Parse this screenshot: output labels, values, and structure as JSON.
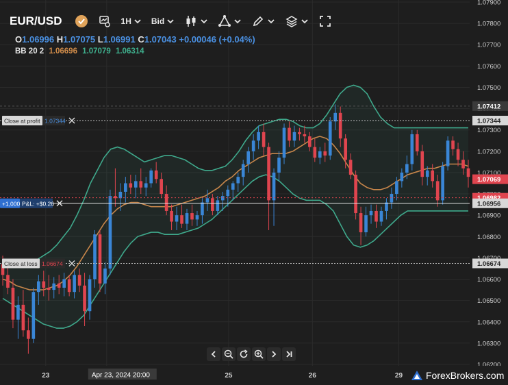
{
  "toolbar": {
    "symbol": "EUR/USD",
    "timeframe": "1H",
    "price_type": "Bid"
  },
  "ohlc": {
    "o_label": "O",
    "o_value": "1.06996",
    "h_label": "H",
    "h_value": "1.07075",
    "l_label": "L",
    "l_value": "1.06991",
    "c_label": "C",
    "c_value": "1.07043",
    "change": "+0.00046 (+0.04%)"
  },
  "indicator": {
    "name": "BB 20 2",
    "middle": "1.06696",
    "upper": "1.07079",
    "lower": "1.06314"
  },
  "orders": {
    "take_profit": {
      "label": "Close at profit",
      "price": "1.07344"
    },
    "stop_loss": {
      "label": "Close at loss",
      "price": "1.06674"
    },
    "position": {
      "size": "+1,000",
      "pnl": "P&L: +$0.26",
      "price": "1.06956"
    }
  },
  "price_markers": {
    "crosshair": "1.07412",
    "last_price": "1.07069",
    "bid_ask": "1.06982"
  },
  "brand": {
    "name": "ForexBrokers.com"
  },
  "colors": {
    "bull": "#3a86d6",
    "bear": "#e0454f",
    "bb_band": "#3fa98c",
    "bb_mid": "#c9874b",
    "background": "#1e1e1e"
  },
  "chart_data": {
    "type": "candlestick",
    "ylim": [
      1.062,
      1.079
    ],
    "y_ticks": [
      "1.07900",
      "1.07800",
      "1.07700",
      "1.07600",
      "1.07500",
      "1.07400",
      "1.07300",
      "1.07200",
      "1.07100",
      "1.07000",
      "1.06900",
      "1.06800",
      "1.06700",
      "1.06600",
      "1.06500",
      "1.06400",
      "1.06300",
      "1.06200"
    ],
    "x_ticks": [
      "23",
      "Apr 23, 2024  20:00",
      "25",
      "26",
      "29"
    ],
    "x_tick_positions": [
      0.09,
      0.21,
      0.45,
      0.615,
      0.785
    ],
    "series": [
      {
        "name": "EUR/USD",
        "candles": [
          [
            1.0667,
            1.0671,
            1.0657,
            1.0662
          ],
          [
            1.0662,
            1.0668,
            1.0653,
            1.0656
          ],
          [
            1.0656,
            1.066,
            1.0637,
            1.0641
          ],
          [
            1.0641,
            1.0652,
            1.0632,
            1.0648
          ],
          [
            1.0648,
            1.0655,
            1.0633,
            1.0636
          ],
          [
            1.0636,
            1.0642,
            1.0625,
            1.0632
          ],
          [
            1.0632,
            1.0656,
            1.063,
            1.0654
          ],
          [
            1.0654,
            1.0662,
            1.0648,
            1.0659
          ],
          [
            1.0659,
            1.0664,
            1.0652,
            1.0656
          ],
          [
            1.0656,
            1.0662,
            1.065,
            1.0655
          ],
          [
            1.0655,
            1.0661,
            1.0651,
            1.0658
          ],
          [
            1.0658,
            1.0662,
            1.0653,
            1.0656
          ],
          [
            1.0656,
            1.0663,
            1.0652,
            1.066
          ],
          [
            1.066,
            1.0662,
            1.0652,
            1.0654
          ],
          [
            1.0654,
            1.0664,
            1.0651,
            1.0662
          ],
          [
            1.0662,
            1.0665,
            1.0654,
            1.0657
          ],
          [
            1.0657,
            1.0663,
            1.0638,
            1.0645
          ],
          [
            1.0645,
            1.0662,
            1.0641,
            1.066
          ],
          [
            1.066,
            1.0683,
            1.0656,
            1.0681
          ],
          [
            1.0681,
            1.0683,
            1.0654,
            1.0658
          ],
          [
            1.0658,
            1.0668,
            1.0653,
            1.0665
          ],
          [
            1.0665,
            1.0702,
            1.0662,
            1.0699
          ],
          [
            1.0699,
            1.0712,
            1.0694,
            1.0698
          ],
          [
            1.0698,
            1.0705,
            1.0692,
            1.0701
          ],
          [
            1.0701,
            1.0708,
            1.0696,
            1.0705
          ],
          [
            1.0705,
            1.0709,
            1.07,
            1.0703
          ],
          [
            1.0703,
            1.0709,
            1.0698,
            1.0706
          ],
          [
            1.0706,
            1.0712,
            1.07,
            1.0703
          ],
          [
            1.0703,
            1.0708,
            1.0699,
            1.0705
          ],
          [
            1.0705,
            1.0712,
            1.0703,
            1.0711
          ],
          [
            1.0711,
            1.0715,
            1.0705,
            1.0707
          ],
          [
            1.0707,
            1.071,
            1.0698,
            1.07
          ],
          [
            1.07,
            1.0704,
            1.069,
            1.0692
          ],
          [
            1.0692,
            1.0695,
            1.0683,
            1.0687
          ],
          [
            1.0687,
            1.0694,
            1.0683,
            1.069
          ],
          [
            1.069,
            1.0695,
            1.0684,
            1.0686
          ],
          [
            1.0686,
            1.0693,
            1.0683,
            1.0691
          ],
          [
            1.0691,
            1.0695,
            1.0685,
            1.0688
          ],
          [
            1.0688,
            1.0692,
            1.0685,
            1.069
          ],
          [
            1.069,
            1.0698,
            1.0686,
            1.0696
          ],
          [
            1.0696,
            1.0702,
            1.0692,
            1.0698
          ],
          [
            1.0698,
            1.07,
            1.069,
            1.0692
          ],
          [
            1.0692,
            1.0699,
            1.069,
            1.0697
          ],
          [
            1.0697,
            1.0701,
            1.0692,
            1.0699
          ],
          [
            1.0699,
            1.0704,
            1.0694,
            1.0702
          ],
          [
            1.0702,
            1.0706,
            1.0697,
            1.0705
          ],
          [
            1.0705,
            1.071,
            1.0701,
            1.0708
          ],
          [
            1.0708,
            1.0716,
            1.0704,
            1.0714
          ],
          [
            1.0714,
            1.0722,
            1.071,
            1.072
          ],
          [
            1.072,
            1.0728,
            1.0716,
            1.0725
          ],
          [
            1.0725,
            1.0732,
            1.0721,
            1.0729
          ],
          [
            1.0729,
            1.0733,
            1.0718,
            1.0722
          ],
          [
            1.0722,
            1.0724,
            1.0683,
            1.0697
          ],
          [
            1.0697,
            1.0712,
            1.0685,
            1.071
          ],
          [
            1.071,
            1.072,
            1.0706,
            1.0717
          ],
          [
            1.0717,
            1.0733,
            1.0714,
            1.0731
          ],
          [
            1.0731,
            1.0734,
            1.0722,
            1.0725
          ],
          [
            1.0725,
            1.0732,
            1.0722,
            1.0729
          ],
          [
            1.0729,
            1.0731,
            1.0725,
            1.0728
          ],
          [
            1.0728,
            1.0732,
            1.0724,
            1.0727
          ],
          [
            1.0727,
            1.0729,
            1.072,
            1.0722
          ],
          [
            1.0722,
            1.0726,
            1.0715,
            1.0717
          ],
          [
            1.0717,
            1.0722,
            1.0714,
            1.072
          ],
          [
            1.072,
            1.0724,
            1.0715,
            1.0718
          ],
          [
            1.0718,
            1.0736,
            1.0716,
            1.0734
          ],
          [
            1.0734,
            1.0742,
            1.073,
            1.0738
          ],
          [
            1.0738,
            1.0741,
            1.0722,
            1.0726
          ],
          [
            1.0726,
            1.0728,
            1.0712,
            1.0716
          ],
          [
            1.0716,
            1.0719,
            1.0707,
            1.0709
          ],
          [
            1.0709,
            1.0711,
            1.0688,
            1.0691
          ],
          [
            1.0691,
            1.0694,
            1.0676,
            1.0682
          ],
          [
            1.0682,
            1.0694,
            1.068,
            1.069
          ],
          [
            1.069,
            1.0695,
            1.0686,
            1.0692
          ],
          [
            1.0692,
            1.0695,
            1.0684,
            1.0687
          ],
          [
            1.0687,
            1.0694,
            1.0685,
            1.0692
          ],
          [
            1.0692,
            1.0698,
            1.0688,
            1.0696
          ],
          [
            1.0696,
            1.0703,
            1.0693,
            1.07
          ],
          [
            1.07,
            1.0708,
            1.0697,
            1.0706
          ],
          [
            1.0706,
            1.0712,
            1.0703,
            1.071
          ],
          [
            1.071,
            1.0718,
            1.0707,
            1.0714
          ],
          [
            1.0714,
            1.073,
            1.0711,
            1.0728
          ],
          [
            1.0728,
            1.073,
            1.0718,
            1.072
          ],
          [
            1.072,
            1.0723,
            1.0704,
            1.0708
          ],
          [
            1.0708,
            1.0713,
            1.0704,
            1.0711
          ],
          [
            1.0711,
            1.0714,
            1.0703,
            1.0706
          ],
          [
            1.0706,
            1.0709,
            1.0694,
            1.0697
          ],
          [
            1.0697,
            1.0715,
            1.0695,
            1.0713
          ],
          [
            1.0713,
            1.0727,
            1.0711,
            1.0725
          ],
          [
            1.0725,
            1.0727,
            1.0718,
            1.0721
          ],
          [
            1.0721,
            1.0724,
            1.0713,
            1.0716
          ],
          [
            1.0716,
            1.072,
            1.0709,
            1.0712
          ],
          [
            1.0712,
            1.0716,
            1.0703,
            1.0708
          ]
        ]
      },
      {
        "name": "BB 20 2 upper",
        "values": [
          1.0668,
          1.0668,
          1.0667,
          1.0667,
          1.0668,
          1.0669,
          1.0671,
          1.0673,
          1.0676,
          1.068,
          1.0684,
          1.069,
          1.0697,
          1.0705,
          1.0711,
          1.0717,
          1.0721,
          1.0722,
          1.0721,
          1.0719,
          1.0717,
          1.0715,
          1.0716,
          1.0717,
          1.0718,
          1.0718,
          1.0717,
          1.0716,
          1.0714,
          1.0712,
          1.0711,
          1.0711,
          1.0712,
          1.0713,
          1.0716,
          1.072,
          1.0725,
          1.0729,
          1.0732,
          1.0733,
          1.0734,
          1.0735,
          1.0735,
          1.0734,
          1.0732,
          1.0731,
          1.0731,
          1.0733,
          1.0737,
          1.0742,
          1.0747,
          1.075,
          1.0751,
          1.075,
          1.0747,
          1.0741,
          1.0736,
          1.0733,
          1.0731,
          1.0731,
          1.0731,
          1.0731,
          1.0731,
          1.0731,
          1.0731,
          1.0731,
          1.0731,
          1.0731,
          1.0731,
          1.0731
        ]
      },
      {
        "name": "BB 20 2 middle",
        "values": [
          1.066,
          1.0659,
          1.0657,
          1.0656,
          1.0655,
          1.0655,
          1.0655,
          1.0656,
          1.0657,
          1.0659,
          1.0662,
          1.0666,
          1.0671,
          1.0676,
          1.0681,
          1.0686,
          1.069,
          1.0693,
          1.0695,
          1.0696,
          1.0696,
          1.0695,
          1.0694,
          1.0694,
          1.0694,
          1.0694,
          1.0695,
          1.0696,
          1.0697,
          1.0698,
          1.0699,
          1.0701,
          1.0703,
          1.0706,
          1.0708,
          1.0711,
          1.0713,
          1.0715,
          1.0717,
          1.0718,
          1.0719,
          1.0719,
          1.0719,
          1.072,
          1.0722,
          1.0724,
          1.0726,
          1.0727,
          1.0726,
          1.0723,
          1.0719,
          1.0714,
          1.0709,
          1.0705,
          1.0703,
          1.0702,
          1.0702,
          1.0703,
          1.0705,
          1.0707,
          1.0709,
          1.071,
          1.0711,
          1.0712,
          1.0712,
          1.0713,
          1.0714,
          1.0714,
          1.0714,
          1.0713
        ]
      },
      {
        "name": "BB 20 2 lower",
        "values": [
          1.0651,
          1.0649,
          1.0647,
          1.0645,
          1.0643,
          1.0641,
          1.0639,
          1.0638,
          1.0637,
          1.0637,
          1.0638,
          1.064,
          1.0643,
          1.0648,
          1.0653,
          1.0658,
          1.0663,
          1.0668,
          1.0673,
          1.0677,
          1.068,
          1.0681,
          1.0682,
          1.0682,
          1.0681,
          1.0681,
          1.0681,
          1.0682,
          1.0683,
          1.0684,
          1.0686,
          1.0688,
          1.0691,
          1.0694,
          1.0697,
          1.07,
          1.0703,
          1.0706,
          1.0708,
          1.0709,
          1.0708,
          1.0706,
          1.0703,
          1.07,
          1.0698,
          1.0697,
          1.0697,
          1.0697,
          1.0695,
          1.0692,
          1.0686,
          1.068,
          1.0676,
          1.0675,
          1.0676,
          1.0678,
          1.0681,
          1.0684,
          1.0687,
          1.069,
          1.0692,
          1.0692,
          1.0692,
          1.0692,
          1.0692,
          1.0692,
          1.0692,
          1.0692,
          1.0692,
          1.0692
        ]
      }
    ]
  }
}
